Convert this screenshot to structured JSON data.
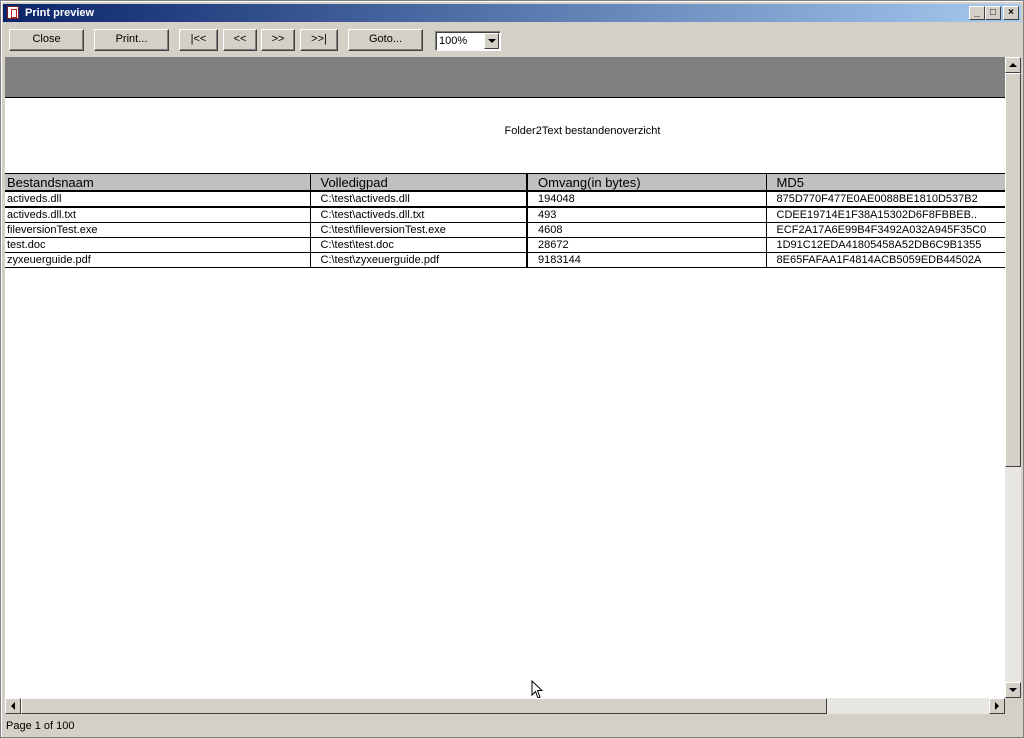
{
  "window": {
    "title": "Print preview",
    "controls": {
      "minimize": "_",
      "maximize": "□",
      "close": "×"
    }
  },
  "toolbar": {
    "close_label": "Close",
    "print_label": "Print...",
    "first_label": "|<<",
    "prev_label": "<<",
    "next_label": ">>",
    "last_label": ">>|",
    "goto_label": "Goto...",
    "zoom_value": "100%"
  },
  "report": {
    "title": "Folder2Text bestandenoverzicht",
    "columns": [
      "Bestandsnaam",
      "Volledigpad",
      "Omvang(in bytes)",
      "MD5"
    ],
    "rows": [
      [
        "activeds.dll",
        "C:\\test\\activeds.dll",
        "194048",
        "875D770F477E0AE0088BE1810D537B2"
      ],
      [
        "activeds.dll.txt",
        "C:\\test\\activeds.dll.txt",
        "493",
        "CDEE19714E1F38A15302D6F8FBBEB.."
      ],
      [
        "fileversionTest.exe",
        "C:\\test\\fileversionTest.exe",
        "4608",
        "ECF2A17A6E99B4F3492A032A945F35C0"
      ],
      [
        "test.doc",
        "C:\\test\\test.doc",
        "28672",
        "1D91C12EDA41805458A52DB6C9B1355"
      ],
      [
        "zyxeuerguide.pdf",
        "C:\\test\\zyxeuerguide.pdf",
        "9183144",
        "8E65FAFAA1F4814ACB5059EDB44502A"
      ]
    ]
  },
  "status": {
    "page_info": "Page 1 of 100"
  },
  "colors": {
    "titlebar_start": "#0a246a",
    "titlebar_end": "#a6caf0",
    "header_band": "#808080",
    "table_header_bg": "#c0c0c0",
    "window_bg": "#d4d0c8"
  },
  "icons": {
    "app": "app-icon",
    "cursor": "mouse-pointer-icon"
  }
}
